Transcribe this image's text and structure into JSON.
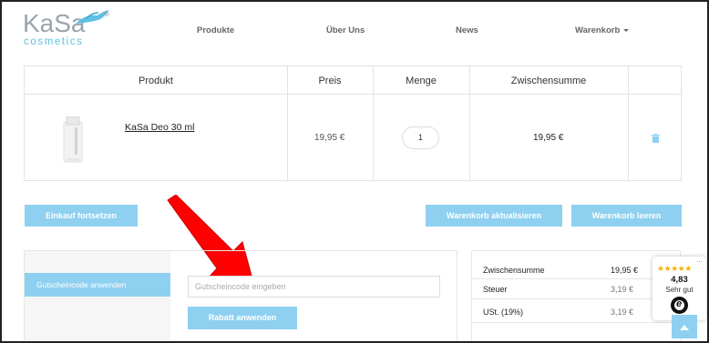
{
  "logo": {
    "brand": "KaSa",
    "sub": "cosmetics",
    "reg": "®"
  },
  "nav": {
    "items": [
      {
        "label": "Produkte"
      },
      {
        "label": "Über Uns"
      },
      {
        "label": "News"
      },
      {
        "label": "Warenkorb"
      }
    ]
  },
  "cart": {
    "headers": [
      "Produkt",
      "Preis",
      "Menge",
      "Zwischensumme"
    ],
    "rows": [
      {
        "name": "KaSa Deo 30 ml",
        "price": "19,95 €",
        "quantity": "1",
        "subtotal": "19,95 €"
      }
    ]
  },
  "buttons": {
    "continue": "Einkauf fortsetzen",
    "update": "Warenkorb aktualisieren",
    "empty": "Warenkorb leeren",
    "apply_discount": "Rabatt anwenden"
  },
  "coupon": {
    "tab_label": "Gutscheincode anwenden",
    "placeholder": "Gutscheincode eingeben"
  },
  "totals": {
    "rows": [
      {
        "label": "Zwischensumme",
        "value": "19,95 €"
      },
      {
        "label": "Steuer",
        "value": "3,19 €"
      },
      {
        "label": "USt. (19%)",
        "value": "3,19 €"
      }
    ]
  },
  "badge": {
    "stars": "★★★★★",
    "dots": "...",
    "score": "4,83",
    "label": "Sehr gut",
    "logo_letter": "e"
  },
  "colors": {
    "accent": "#8fd0f0",
    "arrow": "#ff0000",
    "star": "#f5b301"
  }
}
